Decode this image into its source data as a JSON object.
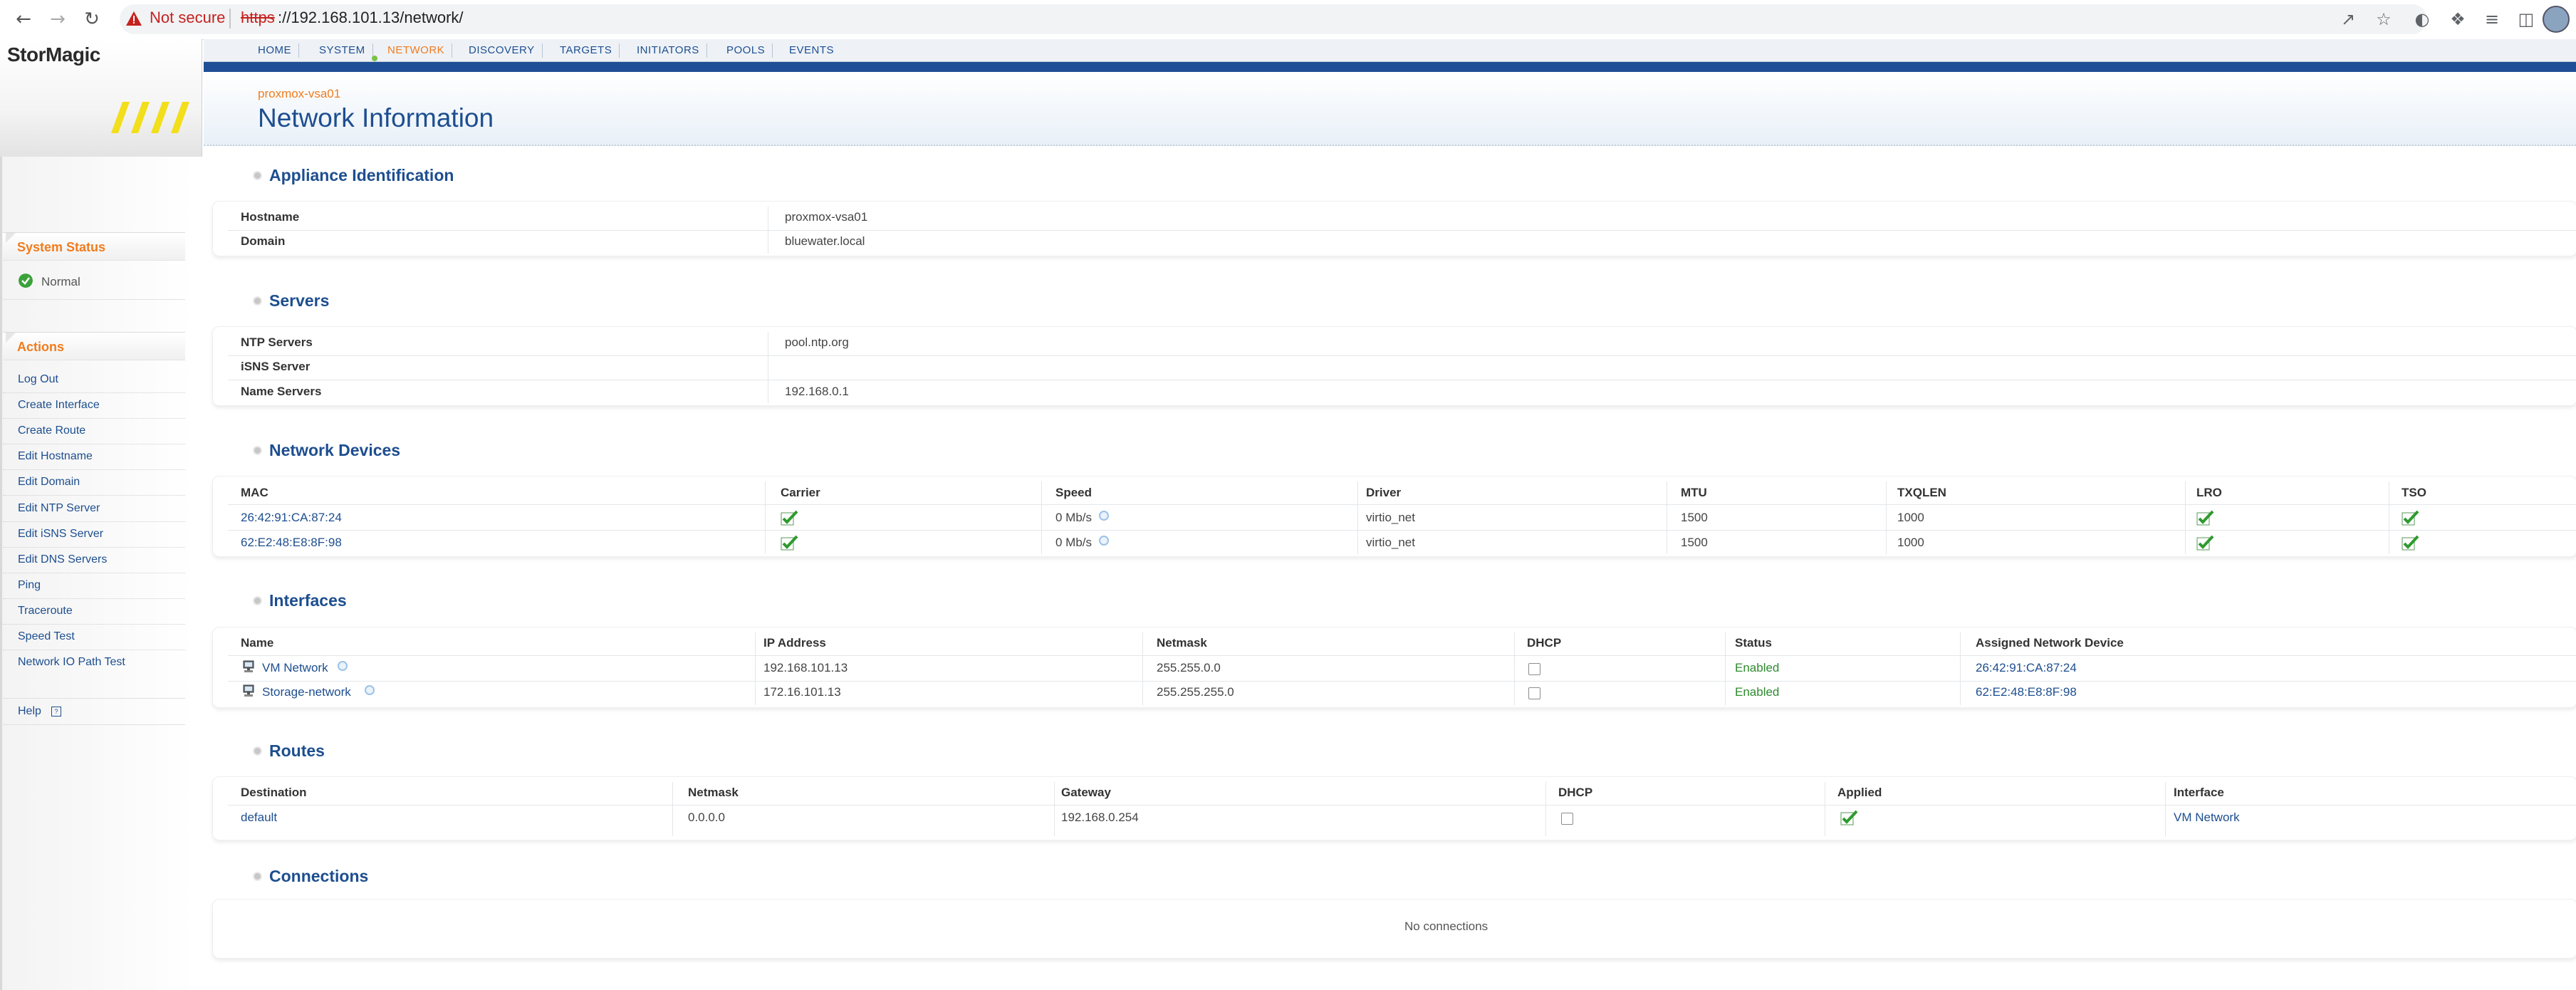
{
  "browser": {
    "security_text": "Not secure",
    "url_scheme": "https",
    "url_rest": "://192.168.101.13/network/"
  },
  "app": {
    "logo_text": "StorMagic",
    "tabs": [
      "HOME",
      "SYSTEM",
      "NETWORK",
      "DISCOVERY",
      "TARGETS",
      "INITIATORS",
      "POOLS",
      "EVENTS"
    ],
    "active_tab": "NETWORK",
    "breadcrumb": "proxmox-vsa01",
    "page_title": "Network Information"
  },
  "sidebar": {
    "status_title": "System Status",
    "status_value": "Normal",
    "actions_title": "Actions",
    "actions": [
      "Log Out",
      "Create Interface",
      "Create Route",
      "Edit Hostname",
      "Edit Domain",
      "Edit NTP Server",
      "Edit iSNS Server",
      "Edit DNS Servers",
      "Ping",
      "Traceroute",
      "Speed Test",
      "Network IO Path Test"
    ],
    "help": "Help"
  },
  "appliance": {
    "title": "Appliance Identification",
    "rows": [
      {
        "label": "Hostname",
        "value": "proxmox-vsa01"
      },
      {
        "label": "Domain",
        "value": "bluewater.local"
      }
    ]
  },
  "servers": {
    "title": "Servers",
    "rows": [
      {
        "label": "NTP Servers",
        "value": "pool.ntp.org"
      },
      {
        "label": "iSNS Server",
        "value": ""
      },
      {
        "label": "Name Servers",
        "value": "192.168.0.1"
      }
    ]
  },
  "devices": {
    "title": "Network Devices",
    "columns": [
      "MAC",
      "Carrier",
      "Speed",
      "Driver",
      "MTU",
      "TXQLEN",
      "LRO",
      "TSO"
    ],
    "rows": [
      {
        "mac": "26:42:91:CA:87:24",
        "carrier": true,
        "speed": "0 Mb/s",
        "driver": "virtio_net",
        "mtu": "1500",
        "txqlen": "1000",
        "lro": true,
        "tso": true
      },
      {
        "mac": "62:E2:48:E8:8F:98",
        "carrier": true,
        "speed": "0 Mb/s",
        "driver": "virtio_net",
        "mtu": "1500",
        "txqlen": "1000",
        "lro": true,
        "tso": true
      }
    ]
  },
  "interfaces": {
    "title": "Interfaces",
    "columns": [
      "Name",
      "IP Address",
      "Netmask",
      "DHCP",
      "Status",
      "Assigned Network Device"
    ],
    "rows": [
      {
        "name": "VM Network",
        "ip": "192.168.101.13",
        "netmask": "255.255.0.0",
        "dhcp": false,
        "status": "Enabled",
        "device": "26:42:91:CA:87:24"
      },
      {
        "name": "Storage-network",
        "ip": "172.16.101.13",
        "netmask": "255.255.255.0",
        "dhcp": false,
        "status": "Enabled",
        "device": "62:E2:48:E8:8F:98"
      }
    ]
  },
  "routes": {
    "title": "Routes",
    "columns": [
      "Destination",
      "Netmask",
      "Gateway",
      "DHCP",
      "Applied",
      "Interface"
    ],
    "rows": [
      {
        "destination": "default",
        "netmask": "0.0.0.0",
        "gateway": "192.168.0.254",
        "dhcp": false,
        "applied": true,
        "interface": "VM Network"
      }
    ]
  },
  "connections": {
    "title": "Connections",
    "empty_text": "No connections"
  }
}
